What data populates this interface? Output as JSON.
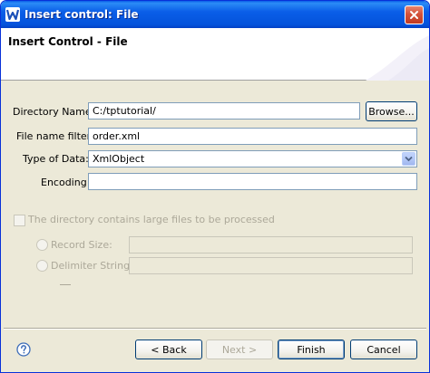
{
  "window": {
    "title": "Insert control: File"
  },
  "banner": {
    "title": "Insert Control - File"
  },
  "form": {
    "directory_label": "Directory Name:",
    "directory_value": "C:/tptutorial/",
    "browse_label": "Browse...",
    "filter_label": "File name filter:",
    "filter_value": "order.xml",
    "type_label": "Type of Data:",
    "type_value": "XmlObject",
    "encoding_label": "Encoding:",
    "encoding_value": "",
    "large_files_label": "The directory contains large files to be processed",
    "large_files_checked": false,
    "record_size_label": "Record Size:",
    "record_size_value": "",
    "delimiter_label": "Delimiter String:",
    "delimiter_value": ""
  },
  "buttons": {
    "back": "< Back",
    "next": "Next >",
    "finish": "Finish",
    "cancel": "Cancel"
  },
  "icons": {
    "app": "app-w-icon",
    "close": "close-icon",
    "help": "help-icon",
    "dropdown": "chevron-down-icon"
  },
  "colors": {
    "titlebar": "#0a5ee8",
    "dialog_bg": "#ece9d8",
    "disabled_text": "#aca899"
  }
}
